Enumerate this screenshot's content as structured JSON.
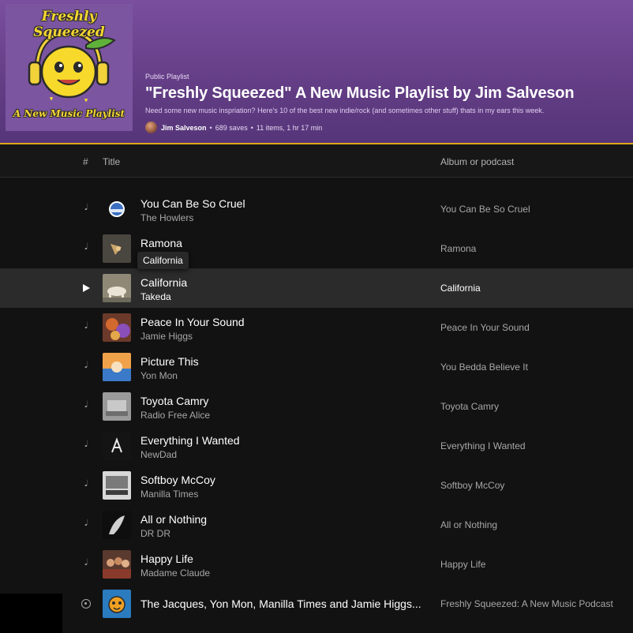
{
  "playlist": {
    "cover_title": "Freshly Squeezed",
    "cover_subtitle": "A New Music Playlist",
    "kind": "Public Playlist",
    "title": "\"Freshly Squeezed\" A New Music Playlist by Jim Salveson",
    "description": "Need some new music inspriation? Here's 10 of the best new indie/rock (and sometimes other stuff) thats in my ears this week.",
    "owner": "Jim Salveson",
    "saves": "689 saves",
    "stats": "11 items, 1 hr 17 min"
  },
  "columns": {
    "number": "#",
    "title": "Title",
    "album": "Album or podcast"
  },
  "tooltip": "California",
  "tracks": [
    {
      "title": "You Can Be So Cruel",
      "artist": "The Howlers",
      "album": "You Can Be So Cruel",
      "icon": "music-note-icon"
    },
    {
      "title": "Ramona",
      "artist": "s",
      "album": "Ramona",
      "icon": "music-note-icon"
    },
    {
      "title": "California",
      "artist": "Takeda",
      "album": "California",
      "icon": "play-icon"
    },
    {
      "title": "Peace In Your Sound",
      "artist": "Jamie Higgs",
      "album": "Peace In Your Sound",
      "icon": "music-note-icon"
    },
    {
      "title": "Picture This",
      "artist": "Yon Mon",
      "album": "You Bedda Believe It",
      "icon": "music-note-icon"
    },
    {
      "title": "Toyota Camry",
      "artist": "Radio Free Alice",
      "album": "Toyota Camry",
      "icon": "music-note-icon"
    },
    {
      "title": "Everything I Wanted",
      "artist": "NewDad",
      "album": "Everything I Wanted",
      "icon": "music-note-icon"
    },
    {
      "title": "Softboy McCoy",
      "artist": "Manilla Times",
      "album": "Softboy McCoy",
      "icon": "music-note-icon"
    },
    {
      "title": "All or Nothing",
      "artist": "DR DR",
      "album": "All or Nothing",
      "icon": "music-note-icon"
    },
    {
      "title": "Happy Life",
      "artist": "Madame Claude",
      "album": "Happy Life",
      "icon": "music-note-icon"
    },
    {
      "title": "The Jacques, Yon Mon, Manilla Times and Jamie Higgs...",
      "artist": "",
      "album": "Freshly Squeezed: A New Music Podcast",
      "icon": "podcast-icon"
    }
  ],
  "colors": {
    "header_purple": "#643e86",
    "accent_gold": "#e0a81a",
    "row_highlight": "#2b2b2b"
  }
}
